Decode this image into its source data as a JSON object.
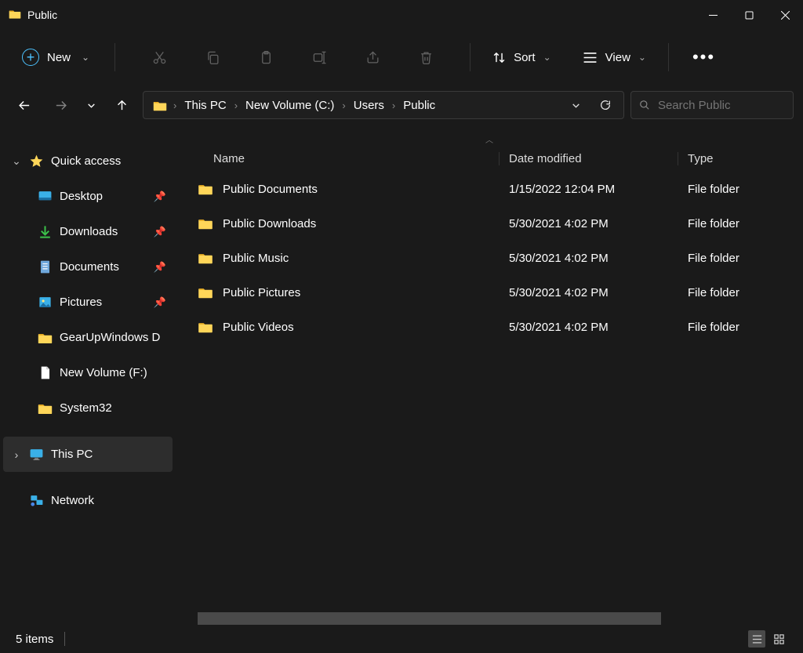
{
  "window": {
    "title": "Public"
  },
  "toolbar": {
    "new_label": "New",
    "sort_label": "Sort",
    "view_label": "View"
  },
  "breadcrumbs": [
    "This PC",
    "New Volume (C:)",
    "Users",
    "Public"
  ],
  "search": {
    "placeholder": "Search Public"
  },
  "sidebar": {
    "quick_access": "Quick access",
    "items": [
      {
        "label": "Desktop"
      },
      {
        "label": "Downloads"
      },
      {
        "label": "Documents"
      },
      {
        "label": "Pictures"
      },
      {
        "label": "GearUpWindows D"
      },
      {
        "label": "New Volume (F:)"
      },
      {
        "label": "System32"
      }
    ],
    "this_pc": "This PC",
    "network": "Network"
  },
  "columns": {
    "name": "Name",
    "date": "Date modified",
    "type": "Type"
  },
  "files": [
    {
      "name": "Public Documents",
      "date": "1/15/2022 12:04 PM",
      "type": "File folder"
    },
    {
      "name": "Public Downloads",
      "date": "5/30/2021 4:02 PM",
      "type": "File folder"
    },
    {
      "name": "Public Music",
      "date": "5/30/2021 4:02 PM",
      "type": "File folder"
    },
    {
      "name": "Public Pictures",
      "date": "5/30/2021 4:02 PM",
      "type": "File folder"
    },
    {
      "name": "Public Videos",
      "date": "5/30/2021 4:02 PM",
      "type": "File folder"
    }
  ],
  "status": {
    "count": "5 items"
  }
}
